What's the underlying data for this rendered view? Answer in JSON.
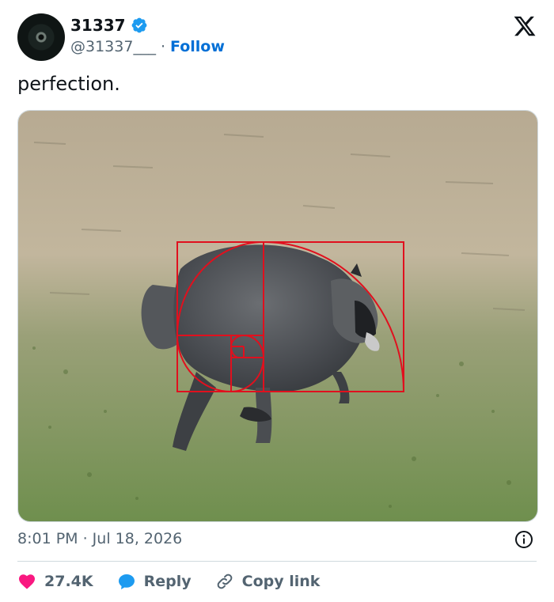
{
  "author": {
    "display_name": "31337",
    "handle": "@31337___",
    "separator": "·",
    "follow_label": "Follow"
  },
  "tweet": {
    "text": "perfection.",
    "timestamp": "8:01 PM · Jul 18, 2026"
  },
  "media": {
    "description": "raccoon walking on grass with golden spiral overlay"
  },
  "actions": {
    "likes": "27.4K",
    "reply_label": "Reply",
    "copy_label": "Copy link"
  },
  "colors": {
    "verified": "#1d9bf0",
    "follow": "#006fd6",
    "like": "#f91880",
    "reply": "#1d9bf0",
    "spiral": "#e0101e"
  }
}
